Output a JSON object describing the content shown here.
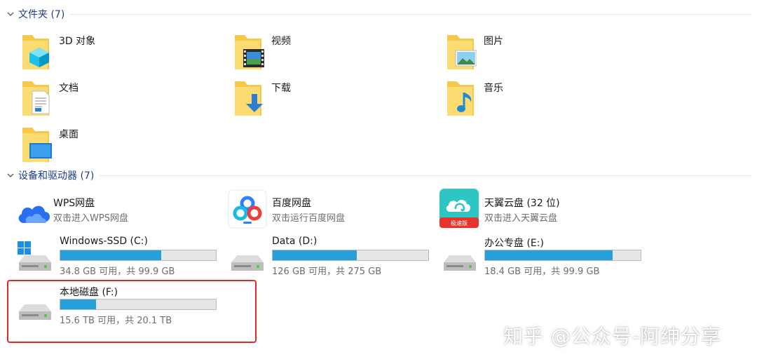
{
  "folders_group": {
    "title": "文件夹 (7)"
  },
  "folders": [
    {
      "label": "3D 对象"
    },
    {
      "label": "视频"
    },
    {
      "label": "图片"
    },
    {
      "label": "文档"
    },
    {
      "label": "下载"
    },
    {
      "label": "音乐"
    },
    {
      "label": "桌面"
    }
  ],
  "devices_group": {
    "title": "设备和驱动器 (7)"
  },
  "devices": [
    {
      "label": "WPS网盘",
      "sub": "双击进入WPS网盘"
    },
    {
      "label": "百度网盘",
      "sub": "双击运行百度网盘"
    },
    {
      "label": "天翼云盘 (32 位)",
      "sub": "双击进入天翼云盘",
      "badge": "极速版"
    }
  ],
  "drives": [
    {
      "label": "Windows-SSD (C:)",
      "free": "34.8 GB 可用，共 99.9 GB",
      "used_fraction": 0.65
    },
    {
      "label": "Data (D:)",
      "free": "126 GB 可用，共 275 GB",
      "used_fraction": 0.54
    },
    {
      "label": "办公专盘 (E:)",
      "free": "18.4 GB 可用，共 99.9 GB",
      "used_fraction": 0.82
    },
    {
      "label": "本地磁盘 (F:)",
      "free": "15.6 TB 可用，共 20.1 TB",
      "used_fraction": 0.23
    }
  ],
  "watermark": "知乎 @公众号-阿绅分享",
  "colors": {
    "group_title": "#1e3c8c",
    "bar_fill": "#26a0da",
    "highlight": "#e02b2b"
  }
}
